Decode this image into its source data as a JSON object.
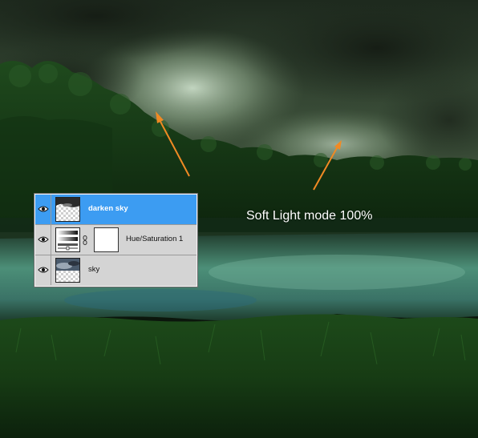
{
  "layers": [
    {
      "name": "darken sky",
      "selected": true,
      "visible": true,
      "thumbnail": "cloud-mask-icon"
    },
    {
      "name": "Hue/Saturation 1",
      "selected": false,
      "visible": true,
      "thumbnail": "hue-saturation-adjustment-icon",
      "mask": "white-mask-icon",
      "link": "chain-link-icon"
    },
    {
      "name": "sky",
      "selected": false,
      "visible": true,
      "thumbnail": "sky-photo-icon"
    }
  ],
  "annotation": "Soft Light mode 100%",
  "colors": {
    "selected_row": "#3c9cf2",
    "panel_bg": "#d4d4d4",
    "arrow": "#f08a24",
    "annotation_text": "#ffffff"
  }
}
